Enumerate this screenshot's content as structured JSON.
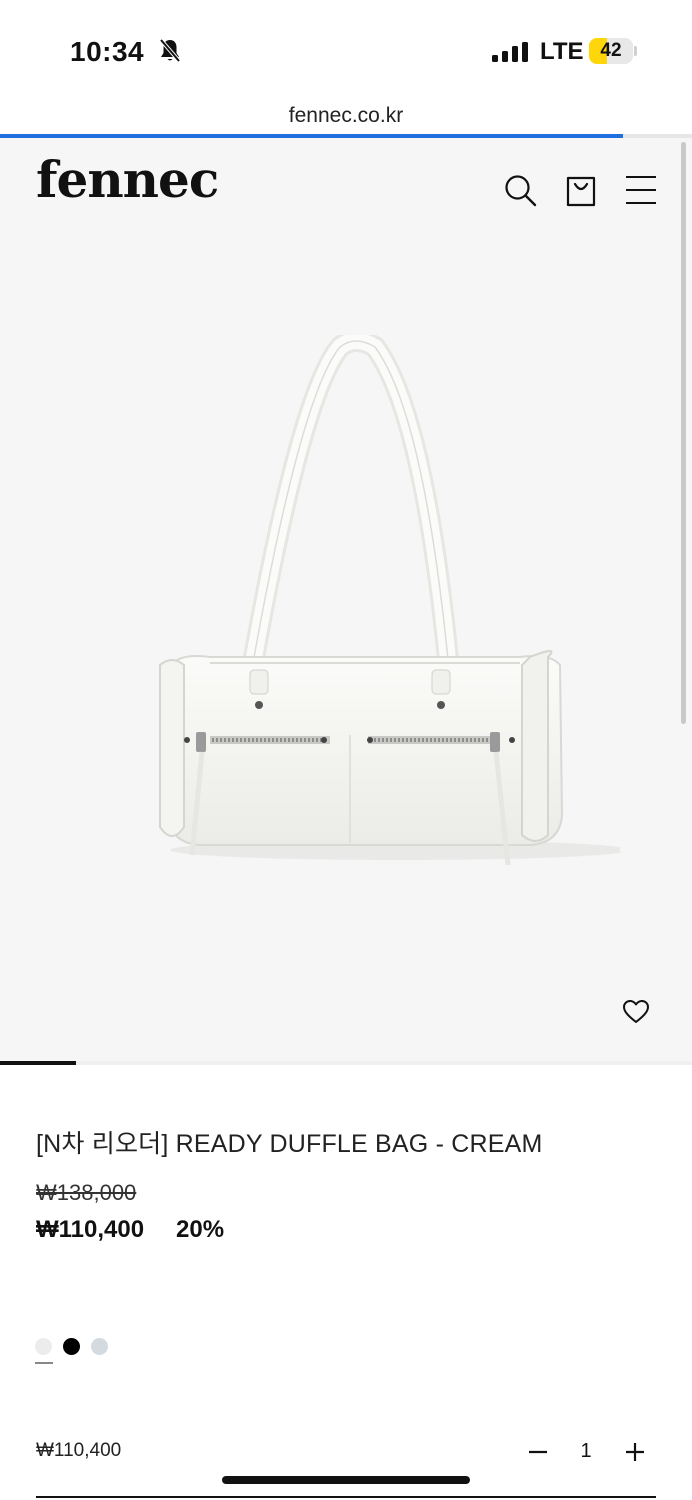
{
  "status_bar": {
    "time": "10:34",
    "network": "LTE",
    "battery": "42",
    "battery_level": 0.42,
    "battery_color": "#ffd60a"
  },
  "browser": {
    "url": "fennec.co.kr",
    "load_progress": 0.9,
    "progress_color": "#1f6fe0"
  },
  "header": {
    "logo": "fennec",
    "icons": [
      "search-icon",
      "shopping-bag-icon",
      "menu-icon"
    ]
  },
  "gallery": {
    "wishlist_icon": "heart-icon",
    "slide_position": 0.11
  },
  "product": {
    "name": "[N차 리오더] READY DUFFLE BAG - CREAM",
    "original_price": "₩138,000",
    "sale_price": "₩110,400",
    "discount": "20%",
    "colors": [
      {
        "name": "cream",
        "hex": "#ececec",
        "selected": true
      },
      {
        "name": "black",
        "hex": "#000000",
        "selected": false
      },
      {
        "name": "gray",
        "hex": "#d3dbe0",
        "selected": false
      }
    ]
  },
  "order": {
    "subtotal": "₩110,400",
    "quantity": "1",
    "decrease_icon": "minus-icon",
    "increase_icon": "plus-icon"
  }
}
